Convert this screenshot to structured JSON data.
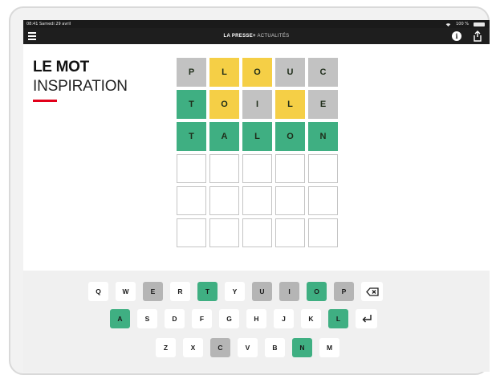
{
  "status": {
    "time_date": "08:41 Samedi 29 avril",
    "battery": "100 %"
  },
  "navbar": {
    "brand": "LA PRESSE+",
    "section": "ACTUALITÉS"
  },
  "header": {
    "title": "LE MOT",
    "subtitle": "INSPIRATION"
  },
  "colors": {
    "green": "#3faf82",
    "yellow": "#f5cf46",
    "gray": "#c2c2c2",
    "accent": "#e2001a"
  },
  "grid": [
    [
      {
        "letter": "P",
        "state": "gray"
      },
      {
        "letter": "L",
        "state": "yellow"
      },
      {
        "letter": "O",
        "state": "yellow"
      },
      {
        "letter": "U",
        "state": "gray"
      },
      {
        "letter": "C",
        "state": "gray"
      }
    ],
    [
      {
        "letter": "T",
        "state": "green"
      },
      {
        "letter": "O",
        "state": "yellow"
      },
      {
        "letter": "I",
        "state": "gray"
      },
      {
        "letter": "L",
        "state": "yellow"
      },
      {
        "letter": "E",
        "state": "gray"
      }
    ],
    [
      {
        "letter": "T",
        "state": "green"
      },
      {
        "letter": "A",
        "state": "green"
      },
      {
        "letter": "L",
        "state": "green"
      },
      {
        "letter": "O",
        "state": "green"
      },
      {
        "letter": "N",
        "state": "green"
      }
    ],
    [
      {
        "letter": "",
        "state": "empty"
      },
      {
        "letter": "",
        "state": "empty"
      },
      {
        "letter": "",
        "state": "empty"
      },
      {
        "letter": "",
        "state": "empty"
      },
      {
        "letter": "",
        "state": "empty"
      }
    ],
    [
      {
        "letter": "",
        "state": "empty"
      },
      {
        "letter": "",
        "state": "empty"
      },
      {
        "letter": "",
        "state": "empty"
      },
      {
        "letter": "",
        "state": "empty"
      },
      {
        "letter": "",
        "state": "empty"
      }
    ],
    [
      {
        "letter": "",
        "state": "empty"
      },
      {
        "letter": "",
        "state": "empty"
      },
      {
        "letter": "",
        "state": "empty"
      },
      {
        "letter": "",
        "state": "empty"
      },
      {
        "letter": "",
        "state": "empty"
      }
    ]
  ],
  "keyboard": {
    "row1": [
      {
        "k": "Q",
        "s": "white"
      },
      {
        "k": "W",
        "s": "white"
      },
      {
        "k": "E",
        "s": "gray"
      },
      {
        "k": "R",
        "s": "white"
      },
      {
        "k": "T",
        "s": "green"
      },
      {
        "k": "Y",
        "s": "white"
      },
      {
        "k": "U",
        "s": "gray"
      },
      {
        "k": "I",
        "s": "gray"
      },
      {
        "k": "O",
        "s": "green"
      },
      {
        "k": "P",
        "s": "gray"
      },
      {
        "k": "backspace-icon",
        "s": "white",
        "icon": true
      }
    ],
    "row2": [
      {
        "k": "A",
        "s": "green"
      },
      {
        "k": "S",
        "s": "white"
      },
      {
        "k": "D",
        "s": "white"
      },
      {
        "k": "F",
        "s": "white"
      },
      {
        "k": "G",
        "s": "white"
      },
      {
        "k": "H",
        "s": "white"
      },
      {
        "k": "J",
        "s": "white"
      },
      {
        "k": "K",
        "s": "white"
      },
      {
        "k": "L",
        "s": "green"
      },
      {
        "k": "enter-icon",
        "s": "white",
        "icon": true
      }
    ],
    "row3": [
      {
        "k": "Z",
        "s": "white"
      },
      {
        "k": "X",
        "s": "white"
      },
      {
        "k": "C",
        "s": "gray"
      },
      {
        "k": "V",
        "s": "white"
      },
      {
        "k": "B",
        "s": "white"
      },
      {
        "k": "N",
        "s": "green"
      },
      {
        "k": "M",
        "s": "white"
      }
    ]
  }
}
